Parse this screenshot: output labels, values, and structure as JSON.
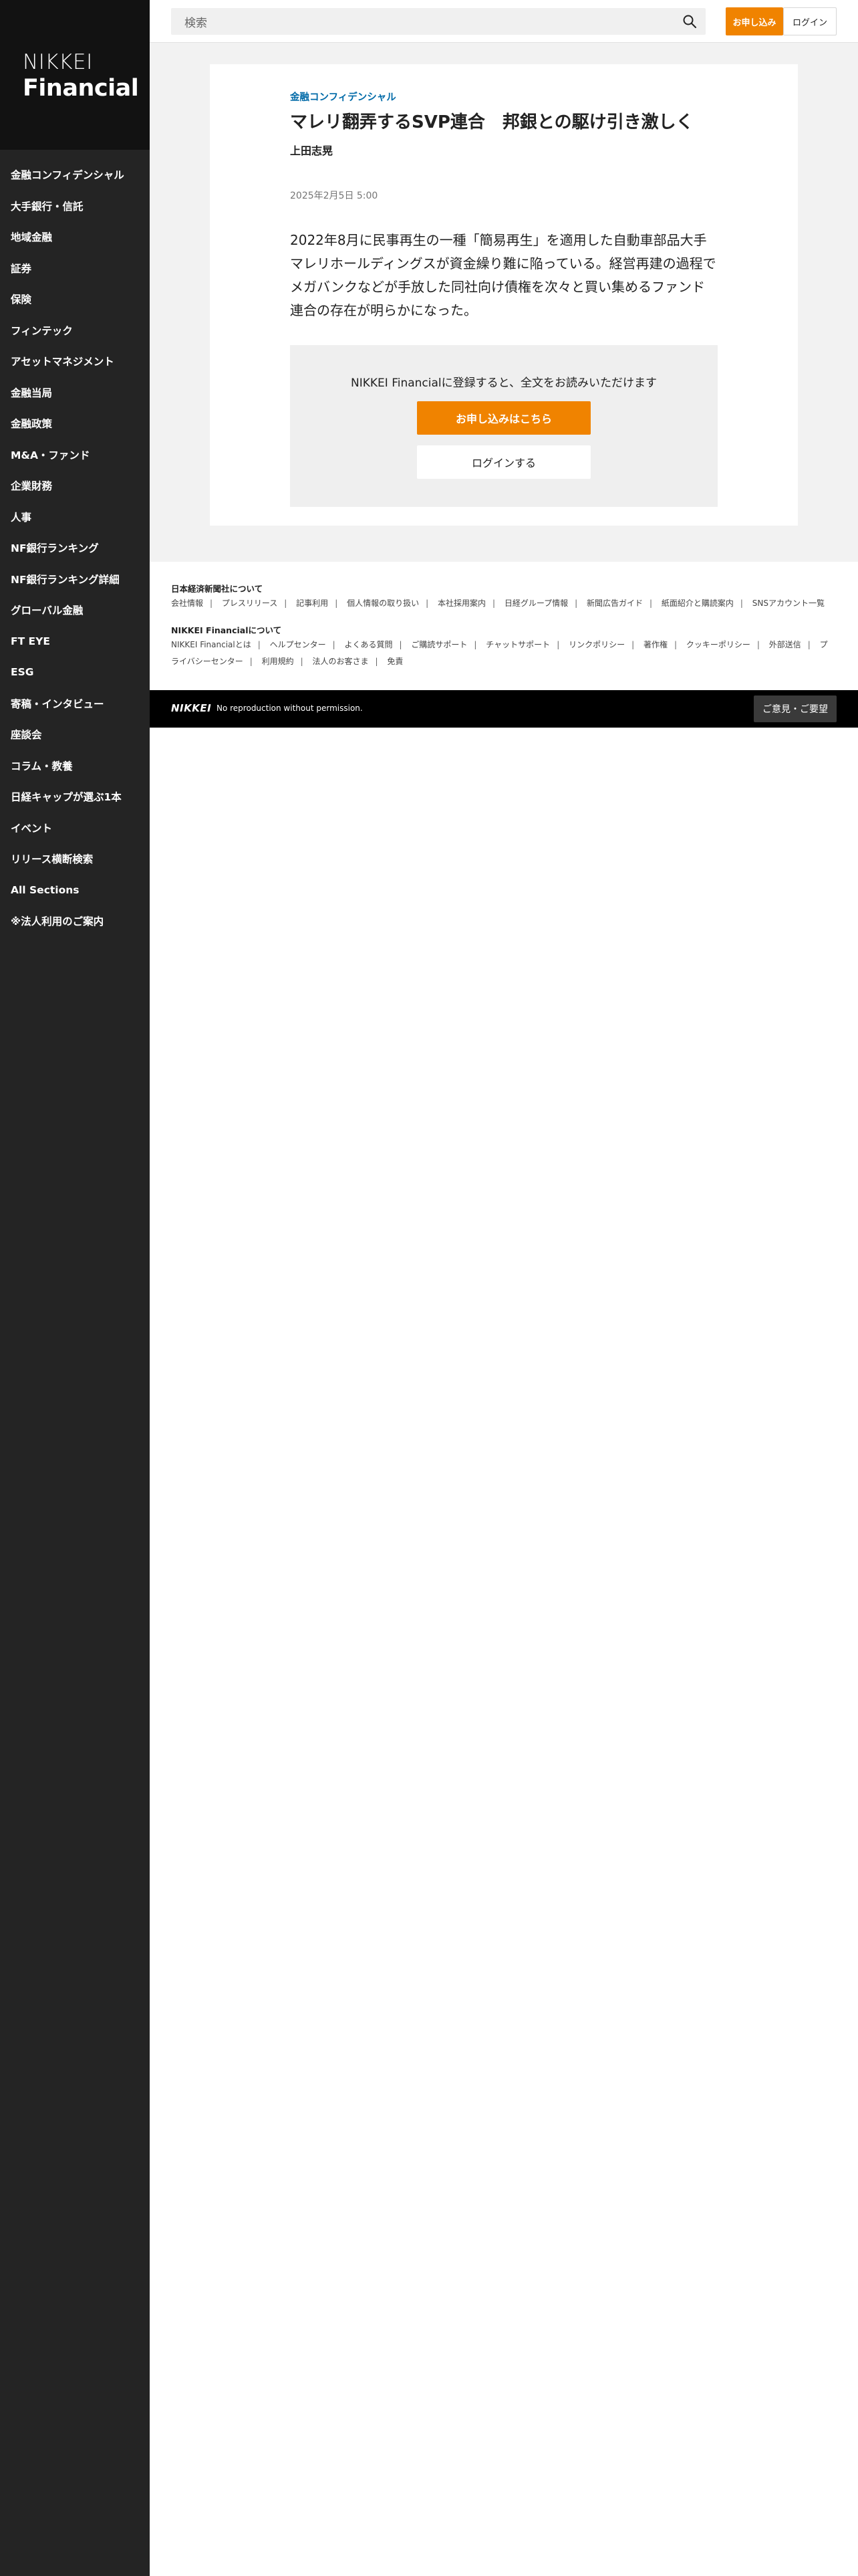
{
  "logo": {
    "line1": "NIKKEI",
    "line2": "Financial"
  },
  "nav": [
    "金融コンフィデンシャル",
    "大手銀行・信託",
    "地域金融",
    "証券",
    "保険",
    "フィンテック",
    "アセットマネジメント",
    "金融当局",
    "金融政策",
    "M&A・ファンド",
    "企業財務",
    "人事",
    "NF銀行ランキング",
    "NF銀行ランキング詳細",
    "グローバル金融",
    "FT EYE",
    "ESG",
    "寄稿・インタビュー",
    "座談会",
    "コラム・教養",
    "日経キャップが選ぶ1本",
    "イベント",
    "リリース横断検索",
    "All Sections",
    "※法人利用のご案内"
  ],
  "header": {
    "search_placeholder": "検索",
    "search_icon": "search-icon",
    "apply_label": "お申し込み",
    "login_label": "ログイン"
  },
  "article": {
    "category": "金融コンフィデンシャル",
    "title": "マレリ翻弄するSVP連合　邦銀との駆け引き激しく",
    "author": "上田志晃",
    "date": "2025年2月5日 5:00",
    "lead": "2022年8月に民事再生の一種「簡易再生」を適用した自動車部品大手マレリホールディングスが資金繰り難に陥っている。経営再建の過程でメガバンクなどが手放した同社向け債権を次々と買い集めるファンド連合の存在が明らかになった。"
  },
  "paywall": {
    "message": "NIKKEI Financialに登録すると、全文をお読みいただけます",
    "apply_label": "お申し込みはこちら",
    "login_label": "ログインする"
  },
  "footer": {
    "heading1": "日本経済新聞社について",
    "links1": [
      "会社情報",
      "プレスリリース",
      "記事利用",
      "個人情報の取り扱い",
      "本社採用案内",
      "日経グループ情報",
      "新聞広告ガイド",
      "紙面紹介と購読案内",
      "SNSアカウント一覧"
    ],
    "heading2": "NIKKEI Financialについて",
    "links2": [
      "NIKKEI Financialとは",
      "ヘルプセンター",
      "よくある質問",
      "ご購読サポート",
      "チャットサポート",
      "リンクポリシー",
      "著作権",
      "クッキーポリシー",
      "外部送信",
      "プライバシーセンター",
      "利用規約",
      "法人のお客さま",
      "免責"
    ]
  },
  "bottom_bar": {
    "logo": "NIKKEI",
    "copyright": "No reproduction without permission.",
    "feedback_label": "ご意見・ご要望"
  },
  "colors": {
    "accent": "#f08300",
    "category": "#006aa8",
    "sidebar": "#242424"
  }
}
